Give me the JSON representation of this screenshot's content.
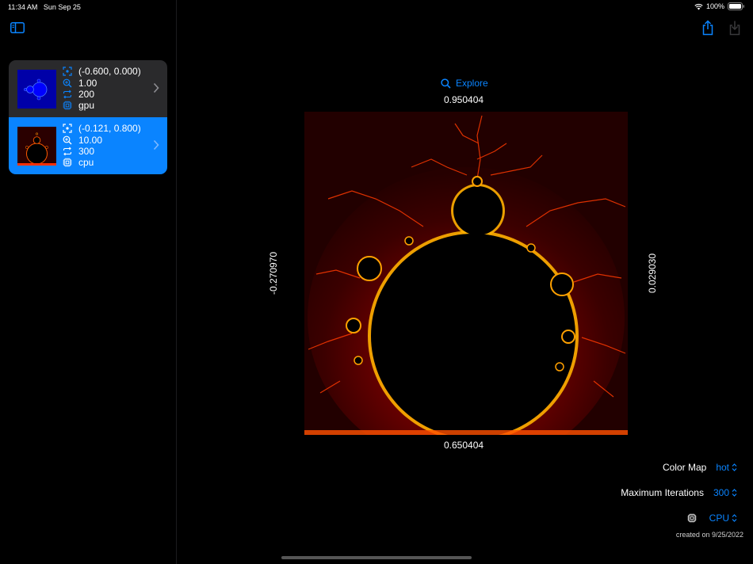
{
  "status": {
    "time": "11:34 AM",
    "date": "Sun Sep 25",
    "battery": "100%"
  },
  "sidebar": {
    "items": [
      {
        "center": "(-0.600, 0.000)",
        "zoom": "1.00",
        "iterations": "200",
        "device": "gpu",
        "selected": false,
        "thumb_color": "#0000c8"
      },
      {
        "center": "(-0.121, 0.800)",
        "zoom": "10.00",
        "iterations": "300",
        "device": "cpu",
        "selected": true,
        "thumb_color": "#ff3000"
      }
    ]
  },
  "detail": {
    "explore_label": "Explore",
    "top_value": "0.950404",
    "bottom_value": "0.650404",
    "left_value": "-0.270970",
    "right_value": "0.029030",
    "color_map_label": "Color Map",
    "color_map_value": "hot",
    "max_iterations_label": "Maximum Iterations",
    "max_iterations_value": "300",
    "device_value": "CPU",
    "created": "created on 9/25/2022"
  },
  "colors": {
    "accent": "#0a84ff",
    "selected_row": "#0a84ff",
    "row_bg": "#2a2a2c"
  }
}
